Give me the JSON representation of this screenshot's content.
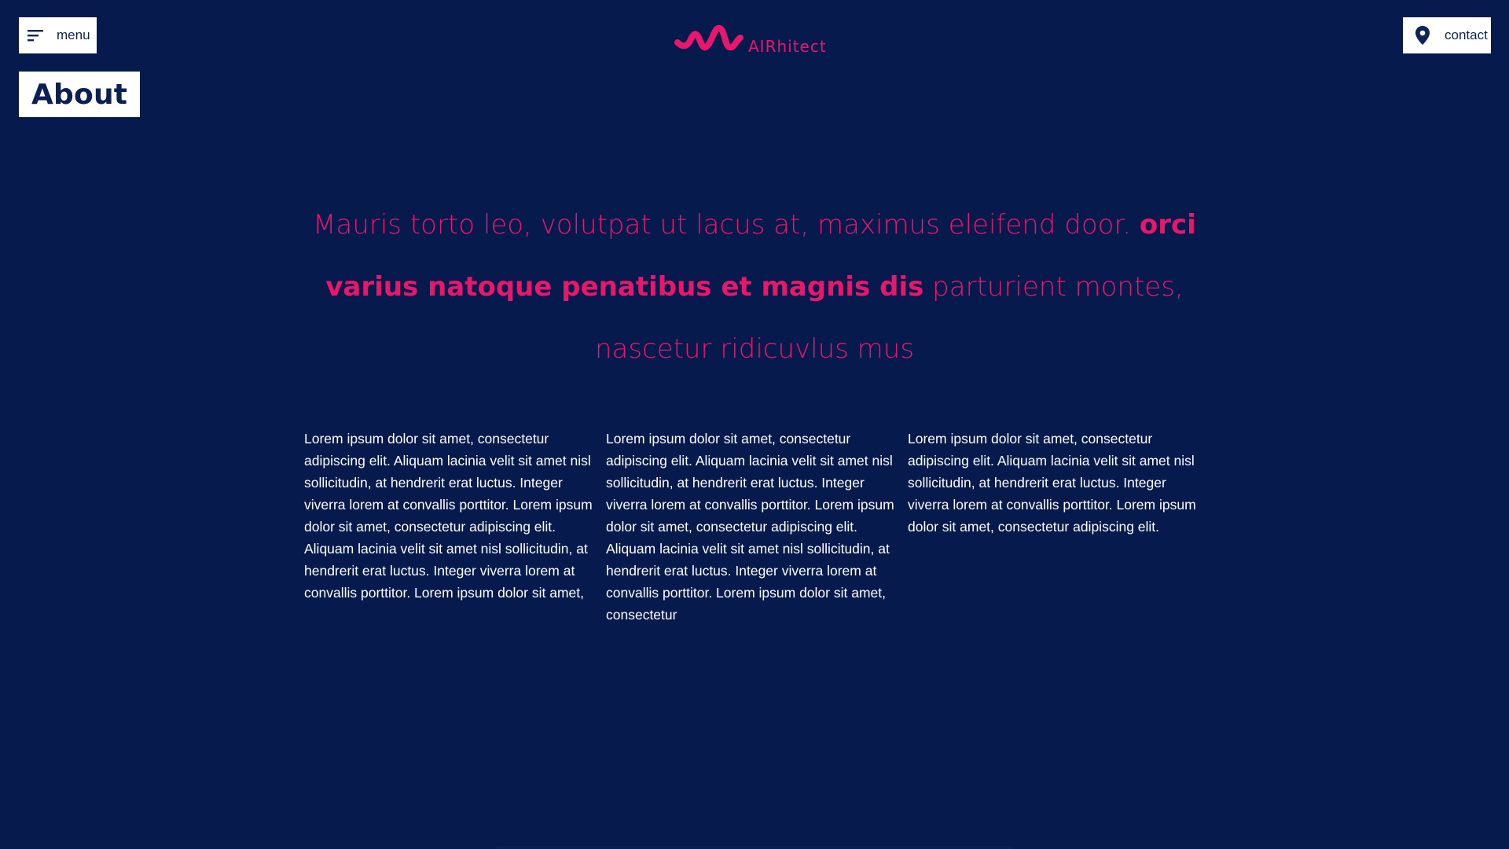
{
  "header": {
    "menu_label": "menu",
    "contact_label": "contact",
    "logo_text": "AIRhitect"
  },
  "page": {
    "section_tag": "About"
  },
  "hero": {
    "part1": "Mauris torto leo, volutpat ut lacus at, maximus eleifend door. ",
    "bold": "orci varius natoque penatibus et magnis dis",
    "part2": " parturient montes, nascetur ridicuvlus mus"
  },
  "columns": [
    "Lorem ipsum dolor sit amet, consectetur adipiscing elit. Aliquam lacinia velit sit amet nisl sollicitudin, at hendrerit erat luctus. Integer viverra lorem at convallis porttitor. Lorem ipsum dolor sit amet, consectetur adipiscing elit. Aliquam lacinia velit sit amet nisl sollicitudin, at hendrerit erat luctus. Integer viverra lorem at convallis porttitor. Lorem ipsum dolor sit amet,",
    "Lorem ipsum dolor sit amet, consectetur adipiscing elit. Aliquam lacinia velit sit amet nisl sollicitudin, at hendrerit erat luctus. Integer viverra lorem at convallis porttitor. Lorem ipsum dolor sit amet, consectetur adipiscing elit. Aliquam lacinia velit sit amet nisl sollicitudin, at hendrerit erat luctus. Integer viverra lorem at convallis porttitor. Lorem ipsum dolor sit amet, consectetur",
    "Lorem ipsum dolor sit amet, consectetur adipiscing elit. Aliquam lacinia velit sit amet nisl sollicitudin, at hendrerit erat luctus. Integer viverra lorem at convallis porttitor. Lorem ipsum dolor sit amet, consectetur adipiscing elit."
  ],
  "colors": {
    "background": "#061a4e",
    "accent": "#e8176b",
    "button_bg": "#ffffff",
    "button_text": "#0e2457"
  },
  "icons": {
    "menu": "sort-lines-icon",
    "contact": "location-pin-icon",
    "logo": "wave-logo-icon"
  }
}
